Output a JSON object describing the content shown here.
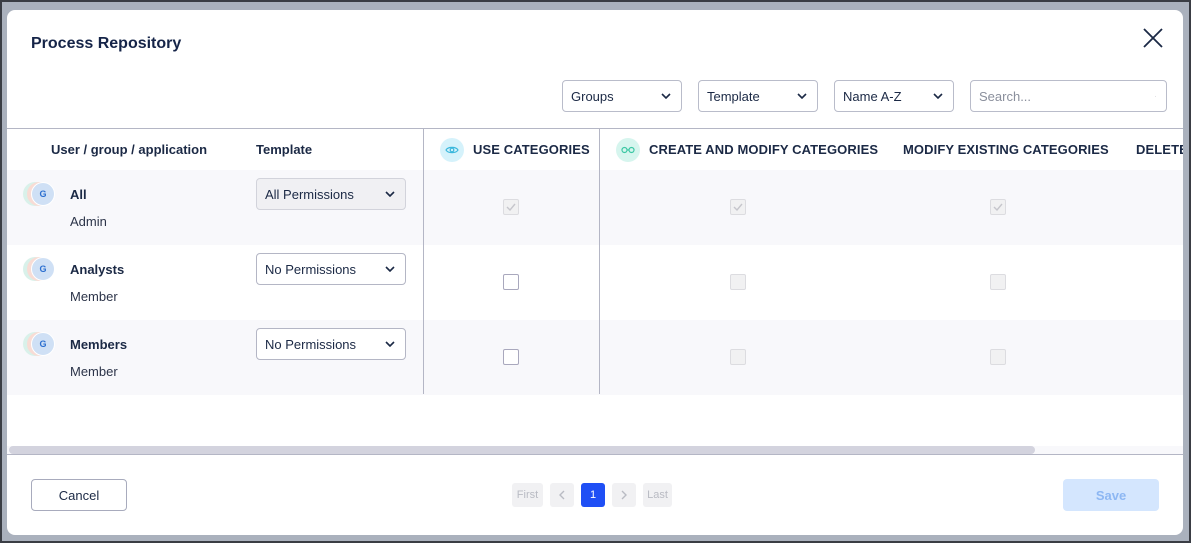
{
  "dialog": {
    "title": "Process Repository",
    "close_icon": "close-icon"
  },
  "toolbar": {
    "filter_type": {
      "value": "Groups",
      "icon": "chevron-down-icon"
    },
    "filter_template": {
      "value": "Template",
      "icon": "chevron-down-icon"
    },
    "sort": {
      "value": "Name A-Z",
      "icon": "chevron-down-icon"
    },
    "search": {
      "value": "",
      "placeholder": "Search...",
      "icon": "search-icon"
    }
  },
  "table": {
    "columns": [
      {
        "label": "User / group / application"
      },
      {
        "label": "Template"
      },
      {
        "label": "USE CATEGORIES",
        "icon": "eye-icon",
        "icon_bg": "#d5f2fb",
        "icon_color": "#3ab7dc"
      },
      {
        "label": "CREATE AND MODIFY CATEGORIES",
        "icon": "glasses-icon",
        "icon_bg": "#d6f5ee",
        "icon_color": "#3cc7a4"
      },
      {
        "label": "MODIFY EXISTING CATEGORIES"
      },
      {
        "label": "DELETE"
      }
    ],
    "rows": [
      {
        "avatar_letter": "G",
        "name": "All",
        "role": "Admin",
        "template": "All Permissions",
        "template_locked": true,
        "use_categories": {
          "checked": true,
          "disabled": true
        },
        "create_modify": {
          "checked": true,
          "disabled": true
        },
        "modify_existing": {
          "checked": true,
          "disabled": true
        }
      },
      {
        "avatar_letter": "G",
        "name": "Analysts",
        "role": "Member",
        "template": "No Permissions",
        "template_locked": false,
        "use_categories": {
          "checked": false,
          "disabled": false
        },
        "create_modify": {
          "checked": false,
          "disabled": true
        },
        "modify_existing": {
          "checked": false,
          "disabled": true
        }
      },
      {
        "avatar_letter": "G",
        "name": "Members",
        "role": "Member",
        "template": "No Permissions",
        "template_locked": false,
        "use_categories": {
          "checked": false,
          "disabled": false
        },
        "create_modify": {
          "checked": false,
          "disabled": true
        },
        "modify_existing": {
          "checked": false,
          "disabled": true
        }
      }
    ]
  },
  "pagination": {
    "first": "First",
    "prev_icon": "chevron-left-icon",
    "current_page": "1",
    "next_icon": "chevron-right-icon",
    "last": "Last"
  },
  "footer": {
    "cancel_label": "Cancel",
    "save_label": "Save"
  },
  "colors": {
    "accent": "#1f4ff5",
    "title_text": "#152448",
    "save_disabled_bg": "#d4e6fe"
  }
}
